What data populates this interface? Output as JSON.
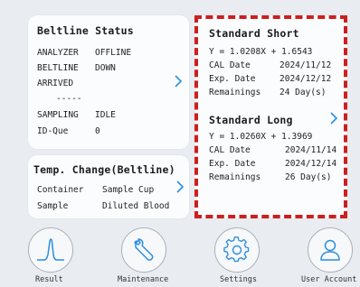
{
  "beltline_card": {
    "title": "Beltline Status",
    "rows": [
      {
        "label": "ANALYZER",
        "value": "OFFLINE"
      },
      {
        "label": "BELTLINE",
        "value": "DOWN"
      },
      {
        "label": "ARRIVED",
        "value": ""
      },
      {
        "label": "-----",
        "value": ""
      },
      {
        "label": "SAMPLING",
        "value": "IDLE"
      },
      {
        "label": "ID-Que",
        "value": "0"
      }
    ]
  },
  "temp_card": {
    "title": "Temp. Change(Beltline)",
    "rows": [
      {
        "label": "Container",
        "value": "Sample Cup"
      },
      {
        "label": "Sample",
        "value": "Diluted Blood"
      }
    ]
  },
  "standard_short": {
    "title": "Standard Short",
    "equation": "Y =  1.0208X + 1.6543",
    "rows": [
      {
        "label": "CAL Date",
        "value": "2024/11/12"
      },
      {
        "label": "Exp. Date",
        "value": "2024/12/12"
      },
      {
        "label": "Remainings",
        "value": "24 Day(s)"
      }
    ]
  },
  "standard_long": {
    "title": "Standard Long",
    "equation": "Y =  1.0260X + 1.3969",
    "rows": [
      {
        "label": "CAL Date",
        "value": "2024/11/14"
      },
      {
        "label": "Exp. Date",
        "value": "2024/12/14"
      },
      {
        "label": "Remainings",
        "value": "26 Day(s)"
      }
    ]
  },
  "nav": [
    {
      "label": "Result",
      "icon": "waveform-icon"
    },
    {
      "label": "Maintenance",
      "icon": "wrench-icon"
    },
    {
      "label": "Settings",
      "icon": "gear-icon"
    },
    {
      "label": "User Account",
      "icon": "user-icon"
    }
  ],
  "colors": {
    "accent": "#2a8ee0",
    "highlight": "#cc1f1f"
  }
}
